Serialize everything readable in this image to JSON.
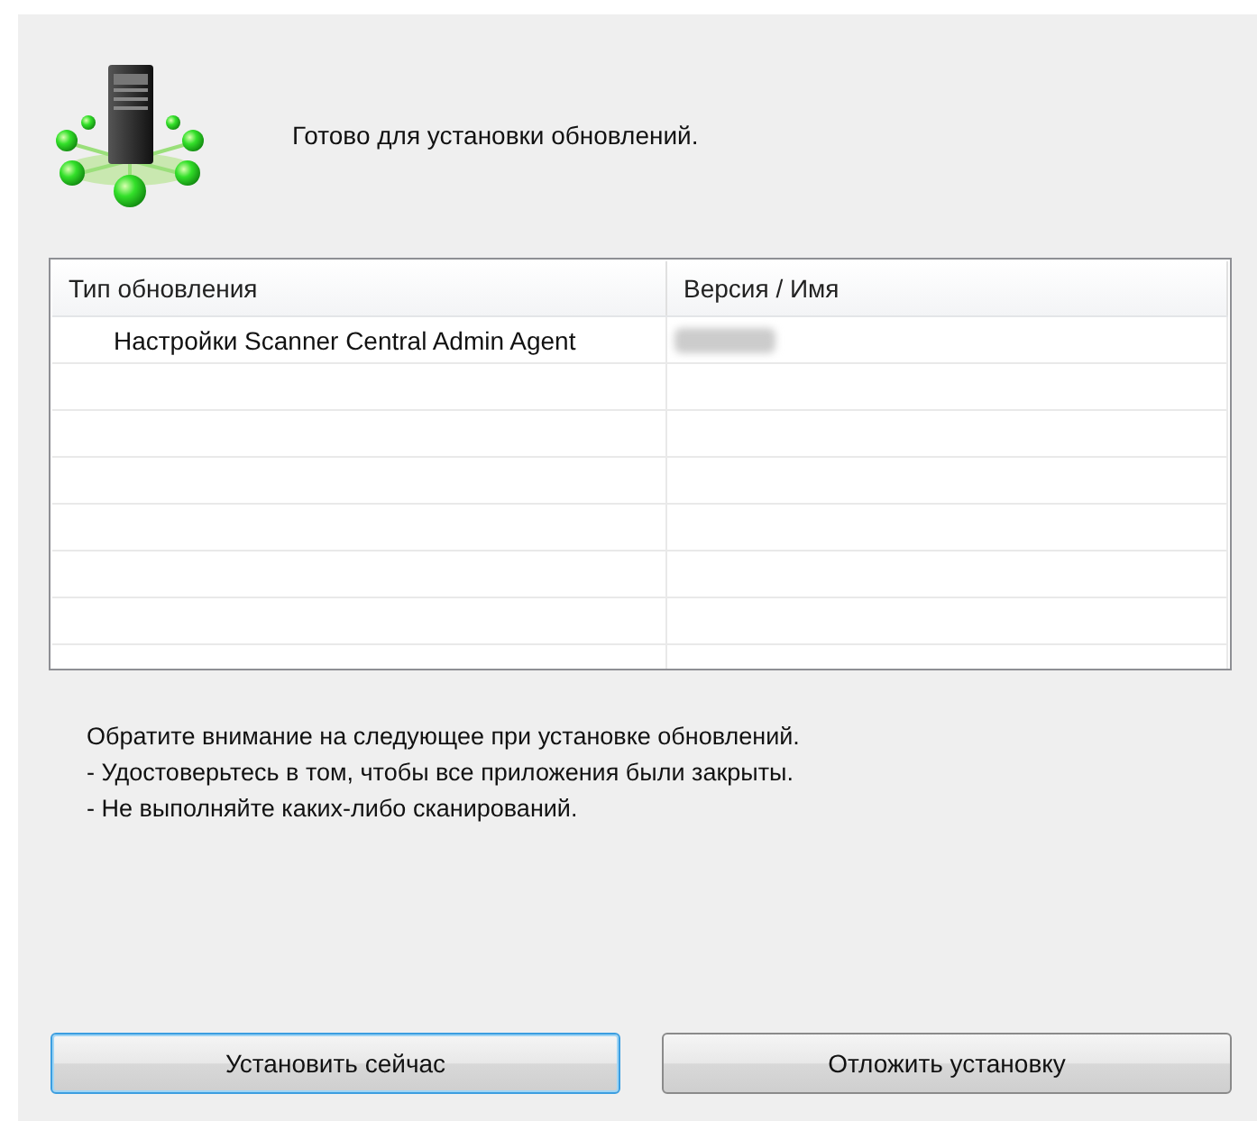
{
  "header": {
    "message": "Готово для установки обновлений."
  },
  "table": {
    "columns": [
      "Тип обновления",
      "Версия / Имя"
    ],
    "rows": [
      {
        "type": "Настройки Scanner Central Admin Agent",
        "version_redacted": true
      }
    ]
  },
  "notes": [
    "Обратите внимание на следующее при установке обновлений.",
    "- Удостоверьтесь в том, чтобы все приложения были закрыты.",
    "- Не выполняйте каких-либо сканирований."
  ],
  "buttons": [
    {
      "label": "Установить сейчас",
      "focused": true
    },
    {
      "label": "Отложить установку",
      "focused": false
    }
  ]
}
